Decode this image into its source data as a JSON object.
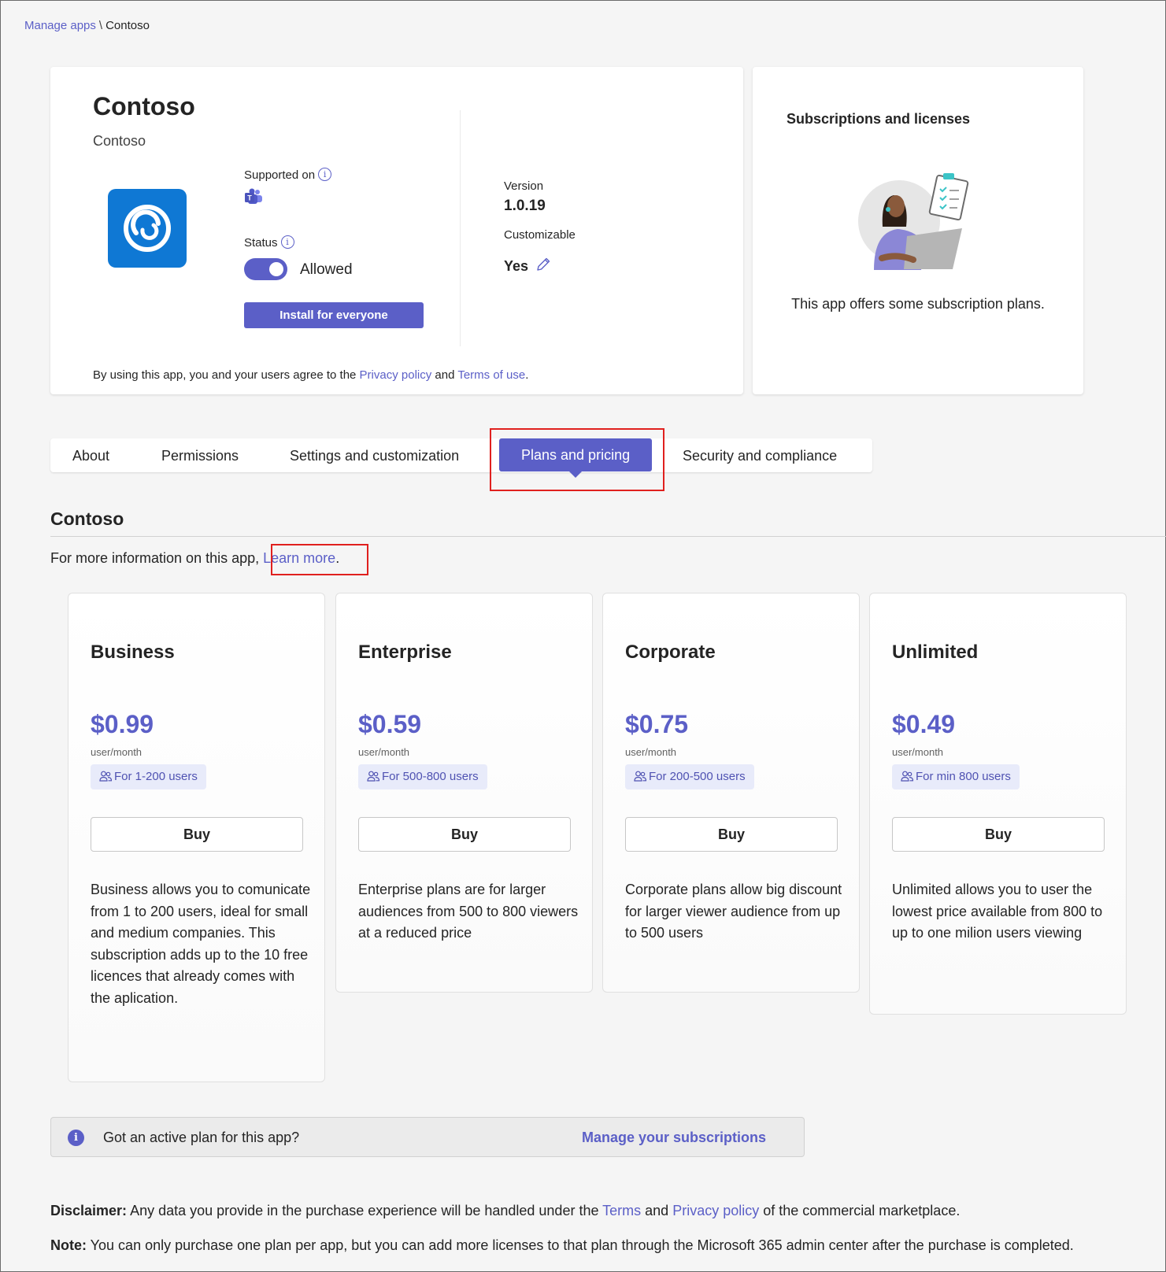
{
  "breadcrumb": {
    "parent": "Manage apps",
    "separator": "\\",
    "current": "Contoso"
  },
  "app": {
    "name": "Contoso",
    "publisher": "Contoso",
    "supported_on_label": "Supported on",
    "status_label": "Status",
    "status_value": "Allowed",
    "install_button": "Install for everyone",
    "version_label": "Version",
    "version_value": "1.0.19",
    "customizable_label": "Customizable",
    "customizable_value": "Yes",
    "agree_prefix": "By using this app, you and your users agree to the ",
    "privacy_link": "Privacy policy",
    "agree_and": " and ",
    "terms_link": "Terms of use",
    "agree_suffix": "."
  },
  "subscriptions_card": {
    "title": "Subscriptions and licenses",
    "text": "This app offers some subscription plans."
  },
  "tabs": [
    {
      "label": "About",
      "active": false
    },
    {
      "label": "Permissions",
      "active": false
    },
    {
      "label": "Settings and customization",
      "active": false
    },
    {
      "label": "Plans and pricing",
      "active": true
    },
    {
      "label": "Security and compliance",
      "active": false
    }
  ],
  "section": {
    "title": "Contoso",
    "info_prefix": "For more information on this app, ",
    "learn_more": "Learn more",
    "info_suffix": "."
  },
  "plans": [
    {
      "name": "Business",
      "price": "$0.99",
      "unit": "user/month",
      "badge": "For 1-200 users",
      "buy": "Buy",
      "description": "Business allows you to comunicate from 1 to 200 users, ideal for small and medium companies. This subscription adds up to the 10 free licences that already comes with the aplication."
    },
    {
      "name": "Enterprise",
      "price": "$0.59",
      "unit": "user/month",
      "badge": "For 500-800 users",
      "buy": "Buy",
      "description": "Enterprise plans are for larger audiences from 500 to 800 viewers at a reduced price"
    },
    {
      "name": "Corporate",
      "price": "$0.75",
      "unit": "user/month",
      "badge": "For 200-500 users",
      "buy": "Buy",
      "description": "Corporate plans allow big discount for larger viewer audience from up to 500 users"
    },
    {
      "name": "Unlimited",
      "price": "$0.49",
      "unit": "user/month",
      "badge": "For min 800 users",
      "buy": "Buy",
      "description": "Unlimited allows you to user the lowest price available from 800 to up to one milion users viewing"
    }
  ],
  "banner": {
    "text": "Got an active plan for this app?",
    "link": "Manage your subscriptions"
  },
  "disclaimer": {
    "label": "Disclaimer:",
    "text_1": " Any data you provide in the purchase experience will be handled under the ",
    "terms_link": "Terms",
    "and": " and ",
    "privacy_link": "Privacy policy",
    "text_2": " of the commercial marketplace."
  },
  "note": {
    "label": "Note:",
    "text": " You can only purchase one plan per app, but you can add more licenses to that plan through the Microsoft 365 admin center after the purchase is completed."
  },
  "colors": {
    "accent": "#5b5fc7",
    "app_logo": "#0f78d4",
    "highlight": "#e0201e"
  }
}
